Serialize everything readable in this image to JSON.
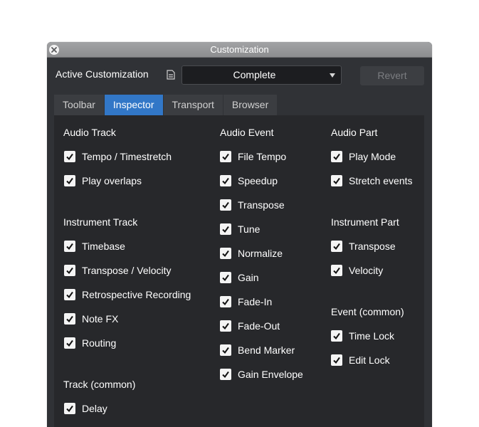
{
  "window": {
    "title": "Customization"
  },
  "header": {
    "label": "Active Customization",
    "selected": "Complete",
    "revert_label": "Revert"
  },
  "tabs": [
    "Toolbar",
    "Inspector",
    "Transport",
    "Browser"
  ],
  "active_tab": "Inspector",
  "colors": {
    "accent": "#3277c7",
    "panel": "#27282b",
    "window": "#303236"
  },
  "columns": [
    {
      "sections": [
        {
          "title": "Audio Track",
          "items": [
            {
              "label": "Tempo / Timestretch",
              "checked": true
            },
            {
              "label": "Play overlaps",
              "checked": true
            }
          ]
        },
        {
          "title": "Instrument Track",
          "items": [
            {
              "label": "Timebase",
              "checked": true
            },
            {
              "label": "Transpose / Velocity",
              "checked": true
            },
            {
              "label": "Retrospective Recording",
              "checked": true
            },
            {
              "label": "Note FX",
              "checked": true
            },
            {
              "label": "Routing",
              "checked": true
            }
          ]
        },
        {
          "title": "Track (common)",
          "items": [
            {
              "label": "Delay",
              "checked": true
            }
          ]
        }
      ]
    },
    {
      "sections": [
        {
          "title": "Audio Event",
          "items": [
            {
              "label": "File Tempo",
              "checked": true
            },
            {
              "label": "Speedup",
              "checked": true
            },
            {
              "label": "Transpose",
              "checked": true
            },
            {
              "label": "Tune",
              "checked": true
            },
            {
              "label": "Normalize",
              "checked": true
            },
            {
              "label": "Gain",
              "checked": true
            },
            {
              "label": "Fade-In",
              "checked": true
            },
            {
              "label": "Fade-Out",
              "checked": true
            },
            {
              "label": "Bend Marker",
              "checked": true
            },
            {
              "label": "Gain Envelope",
              "checked": true
            }
          ]
        }
      ]
    },
    {
      "sections": [
        {
          "title": "Audio Part",
          "items": [
            {
              "label": "Play Mode",
              "checked": true
            },
            {
              "label": "Stretch events",
              "checked": true
            }
          ]
        },
        {
          "title": "Instrument Part",
          "items": [
            {
              "label": "Transpose",
              "checked": true
            },
            {
              "label": "Velocity",
              "checked": true
            }
          ]
        },
        {
          "title": "Event (common)",
          "items": [
            {
              "label": "Time Lock",
              "checked": true
            },
            {
              "label": "Edit Lock",
              "checked": true
            }
          ]
        }
      ]
    }
  ]
}
